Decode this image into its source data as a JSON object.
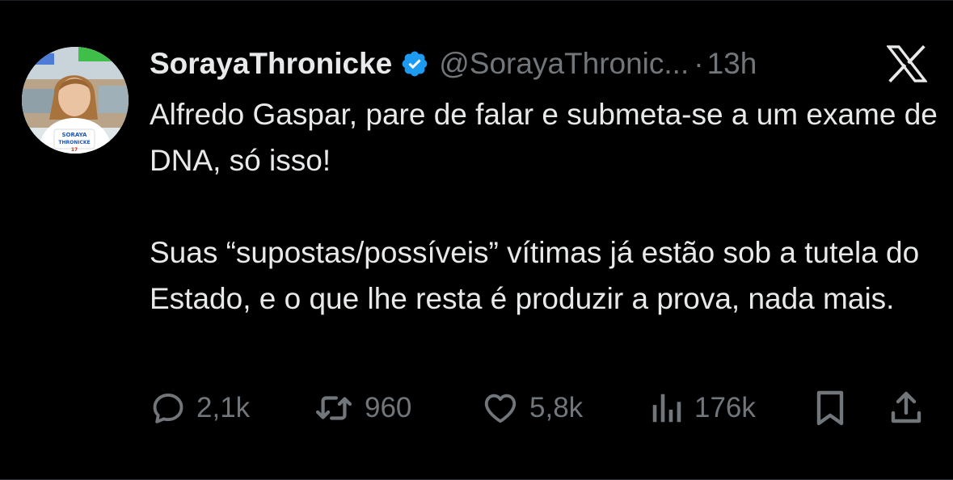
{
  "tweet": {
    "display_name": "SorayaThronicke",
    "handle": "@SorayaThronic...",
    "separator": "·",
    "time": "13h",
    "paragraphs": [
      "Alfredo Gaspar, pare de falar e submeta-se a um exame de DNA, só isso!",
      "Suas “supostas/possíveis” vítimas já estão sob a tutela do Estado, e o que lhe resta é produzir a prova, nada mais."
    ]
  },
  "avatar": {
    "badge_line1": "SORAYA",
    "badge_line2": "THRONICKE",
    "badge_number": "17"
  },
  "actions": {
    "replies": "2,1k",
    "retweets": "960",
    "likes": "5,8k",
    "views": "176k"
  },
  "icons": {
    "verified": "verified-badge-icon",
    "logo": "x-logo-icon",
    "reply": "reply-icon",
    "retweet": "retweet-icon",
    "like": "heart-icon",
    "views": "views-icon",
    "bookmark": "bookmark-icon",
    "share": "share-icon"
  },
  "colors": {
    "background": "#000000",
    "primary_text": "#e7e9ea",
    "secondary_text": "#71767b",
    "verified_blue": "#1d9bf0"
  }
}
